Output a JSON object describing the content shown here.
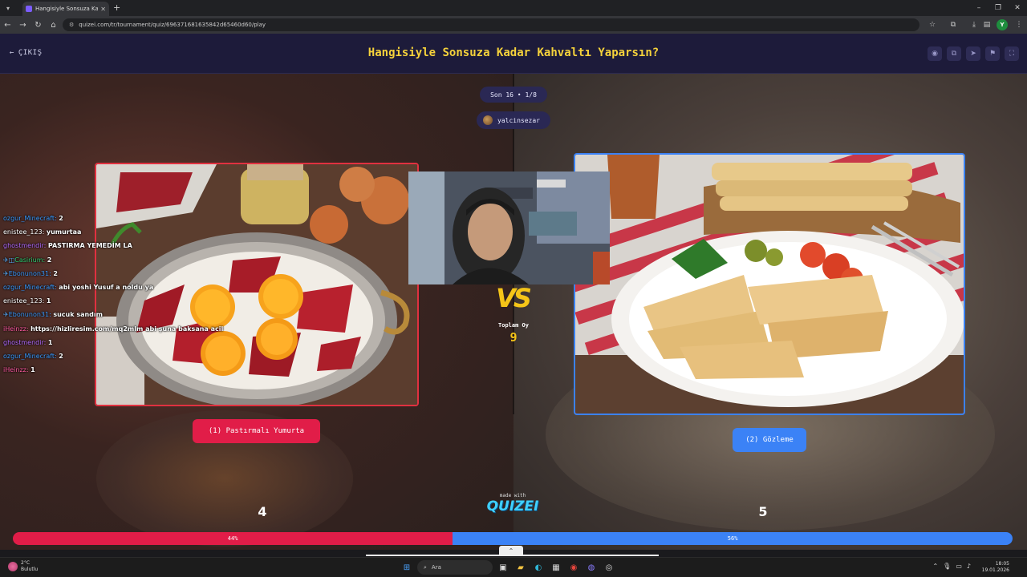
{
  "browser": {
    "tab_title": "Hangisiyle Sonsuza Kadar Kahv...",
    "url": "quizei.com/tr/tournament/quiz/696371681635842d65460d60/play",
    "profile_initial": "Y"
  },
  "header": {
    "exit_label": "ÇIKIŞ",
    "title": "Hangisiyle Sonsuza Kadar Kahvaltı Yaparsın?"
  },
  "match": {
    "round": "Son 16 • 1/8",
    "username": "yalcinsezar",
    "vs_text": "VS",
    "total_label": "Toplam Oy",
    "total_votes": "9",
    "left": {
      "label": "(1) Pastırmalı Yumurta",
      "votes": "4",
      "percent_label": "44%",
      "percent": 44,
      "color": "#e11d48"
    },
    "right": {
      "label": "(2) Gözleme",
      "votes": "5",
      "percent_label": "56%",
      "percent": 56,
      "color": "#3b82f6"
    }
  },
  "branding": {
    "made_with": "made with",
    "name": "QUIZEI"
  },
  "chat": [
    {
      "user": "ozgur_Minecraft:",
      "msg": "2",
      "color": "#3a9bff",
      "badge": ""
    },
    {
      "user": "enistee_123:",
      "msg": "yumurtaa",
      "color": "#ffffff",
      "badge": ""
    },
    {
      "user": "ghostmendir:",
      "msg": "PASTIRMA YEMEDİM LA",
      "color": "#b36bff",
      "badge": ""
    },
    {
      "user": "Casirium:",
      "msg": "2",
      "color": "#2ecc71",
      "badge": "✈◫"
    },
    {
      "user": "Ebonunon31:",
      "msg": "2",
      "color": "#3a9bff",
      "badge": "✈"
    },
    {
      "user": "ozgur_Minecraft:",
      "msg": "abi yoshi Yusuf a noldu ya",
      "color": "#3a9bff",
      "badge": ""
    },
    {
      "user": "enistee_123:",
      "msg": "1",
      "color": "#ffffff",
      "badge": ""
    },
    {
      "user": "Ebonunon31:",
      "msg": "sucuk sandım",
      "color": "#3a9bff",
      "badge": "✈"
    },
    {
      "user": "iHeinzz:",
      "msg": "https://hizliresim.com/mq2mlm abi şuna baksana acil",
      "color": "#ff5aa0",
      "badge": ""
    },
    {
      "user": "ghostmendir:",
      "msg": "1",
      "color": "#b36bff",
      "badge": ""
    },
    {
      "user": "ozgur_Minecraft:",
      "msg": "2",
      "color": "#3a9bff",
      "badge": ""
    },
    {
      "user": "iHeinzz:",
      "msg": "1",
      "color": "#ff5aa0",
      "badge": ""
    }
  ],
  "taskbar": {
    "weather_temp": "2°C",
    "weather_desc": "Bulutlu",
    "search_placeholder": "Ara",
    "time": "18:05",
    "date": "19.01.2026"
  }
}
